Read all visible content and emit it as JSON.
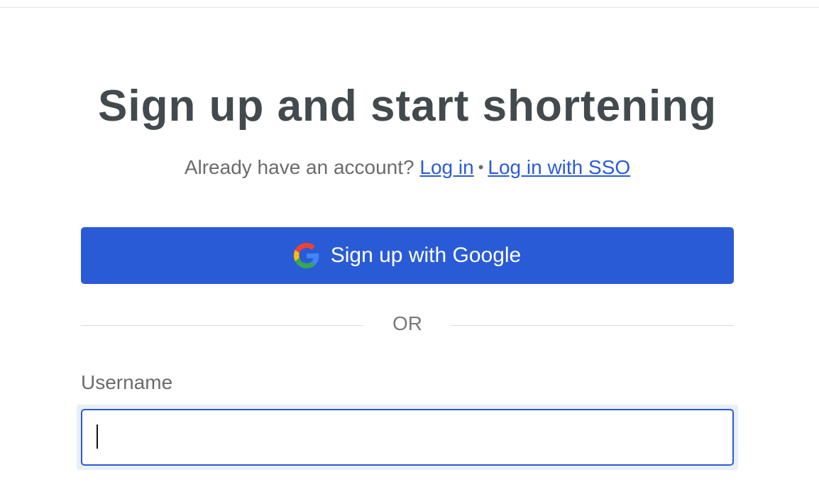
{
  "page": {
    "title": "Sign up and start shortening",
    "already_have_account": "Already have an account?",
    "login_link": "Log in",
    "separator": "•",
    "sso_link": "Log in with SSO"
  },
  "google_button": {
    "label": "Sign up with Google",
    "icon": "google-icon",
    "color": "#2a5bd7"
  },
  "divider": {
    "text": "OR"
  },
  "form": {
    "username_label": "Username",
    "username_value": "",
    "username_placeholder": ""
  }
}
